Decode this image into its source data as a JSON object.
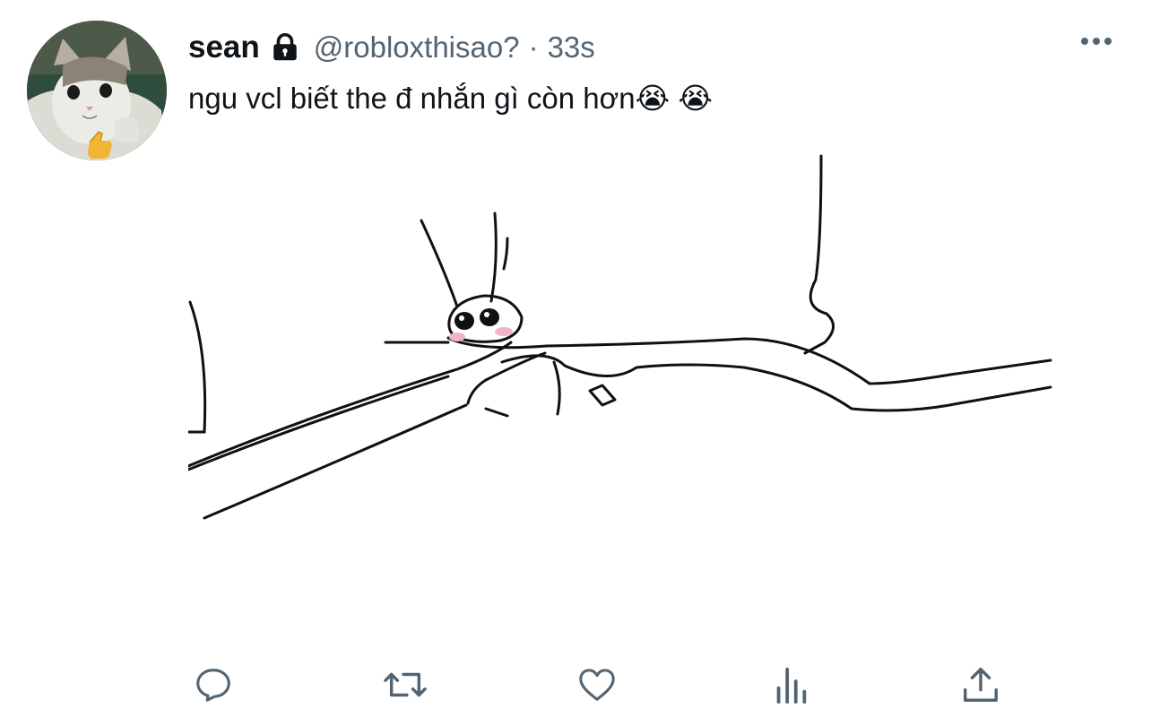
{
  "tweet": {
    "display_name": "sean",
    "handle": "@robloxthisao?",
    "separator": "·",
    "timestamp": "33s",
    "text": "ngu vcl biết the đ nhắn gì còn hơn😭 😭"
  },
  "icons": {
    "lock": "lock-icon",
    "more": "more-horizontal-icon",
    "reply": "reply-icon",
    "retweet": "retweet-icon",
    "like": "heart-icon",
    "analytics": "analytics-icon",
    "share": "share-icon"
  },
  "colors": {
    "text_primary": "#0f1419",
    "text_secondary": "#536471",
    "icon": "#536471",
    "background": "#ffffff"
  }
}
